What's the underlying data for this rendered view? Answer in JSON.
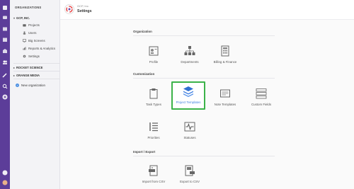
{
  "sidebar": {
    "header": "ORGANIZATIONS",
    "orgs": [
      {
        "name": "GCP, INC.",
        "expanded": true
      },
      {
        "name": "ROCKET SCIENCE",
        "expanded": false
      },
      {
        "name": "ORANGE MEDIA",
        "expanded": false
      }
    ],
    "items": [
      {
        "label": "Projects",
        "icon": "briefcase-icon"
      },
      {
        "label": "Users",
        "icon": "users-icon"
      },
      {
        "label": "Big Screens",
        "icon": "monitor-icon"
      },
      {
        "label": "Reports & Analytics",
        "icon": "chart-icon"
      },
      {
        "label": "Settings",
        "icon": "gear-icon"
      }
    ],
    "new_org_label": "New organization"
  },
  "topbar": {
    "org_name": "GCP, Inc.",
    "page_title": "Settings"
  },
  "sections": [
    {
      "title": "Organization",
      "tiles": [
        {
          "label": "Profile",
          "icon": "profile-card-icon"
        },
        {
          "label": "Departments",
          "icon": "org-chart-icon"
        },
        {
          "label": "Billing & Finance",
          "icon": "calculator-icon"
        }
      ]
    },
    {
      "title": "Customization",
      "tiles": [
        {
          "label": "Task Types",
          "icon": "clipboard-icon"
        },
        {
          "label": "Project Templates",
          "icon": "layers-icon",
          "active": true
        },
        {
          "label": "Note Templates",
          "icon": "note-icon"
        },
        {
          "label": "Custom Fields",
          "icon": "fields-icon"
        },
        {
          "label": "Priorities",
          "icon": "priority-list-icon"
        },
        {
          "label": "Statuses",
          "icon": "pulse-icon"
        }
      ]
    },
    {
      "title": "Import / Export",
      "tiles": [
        {
          "label": "Import from CSV",
          "icon": "csv-import-icon"
        },
        {
          "label": "Export to CSV",
          "icon": "csv-export-icon"
        }
      ]
    }
  ],
  "colors": {
    "rail": "#5c3d99",
    "active_border": "#3cb34a",
    "active_label": "#3f7fe0",
    "accent_blue": "#3f7fe0"
  }
}
